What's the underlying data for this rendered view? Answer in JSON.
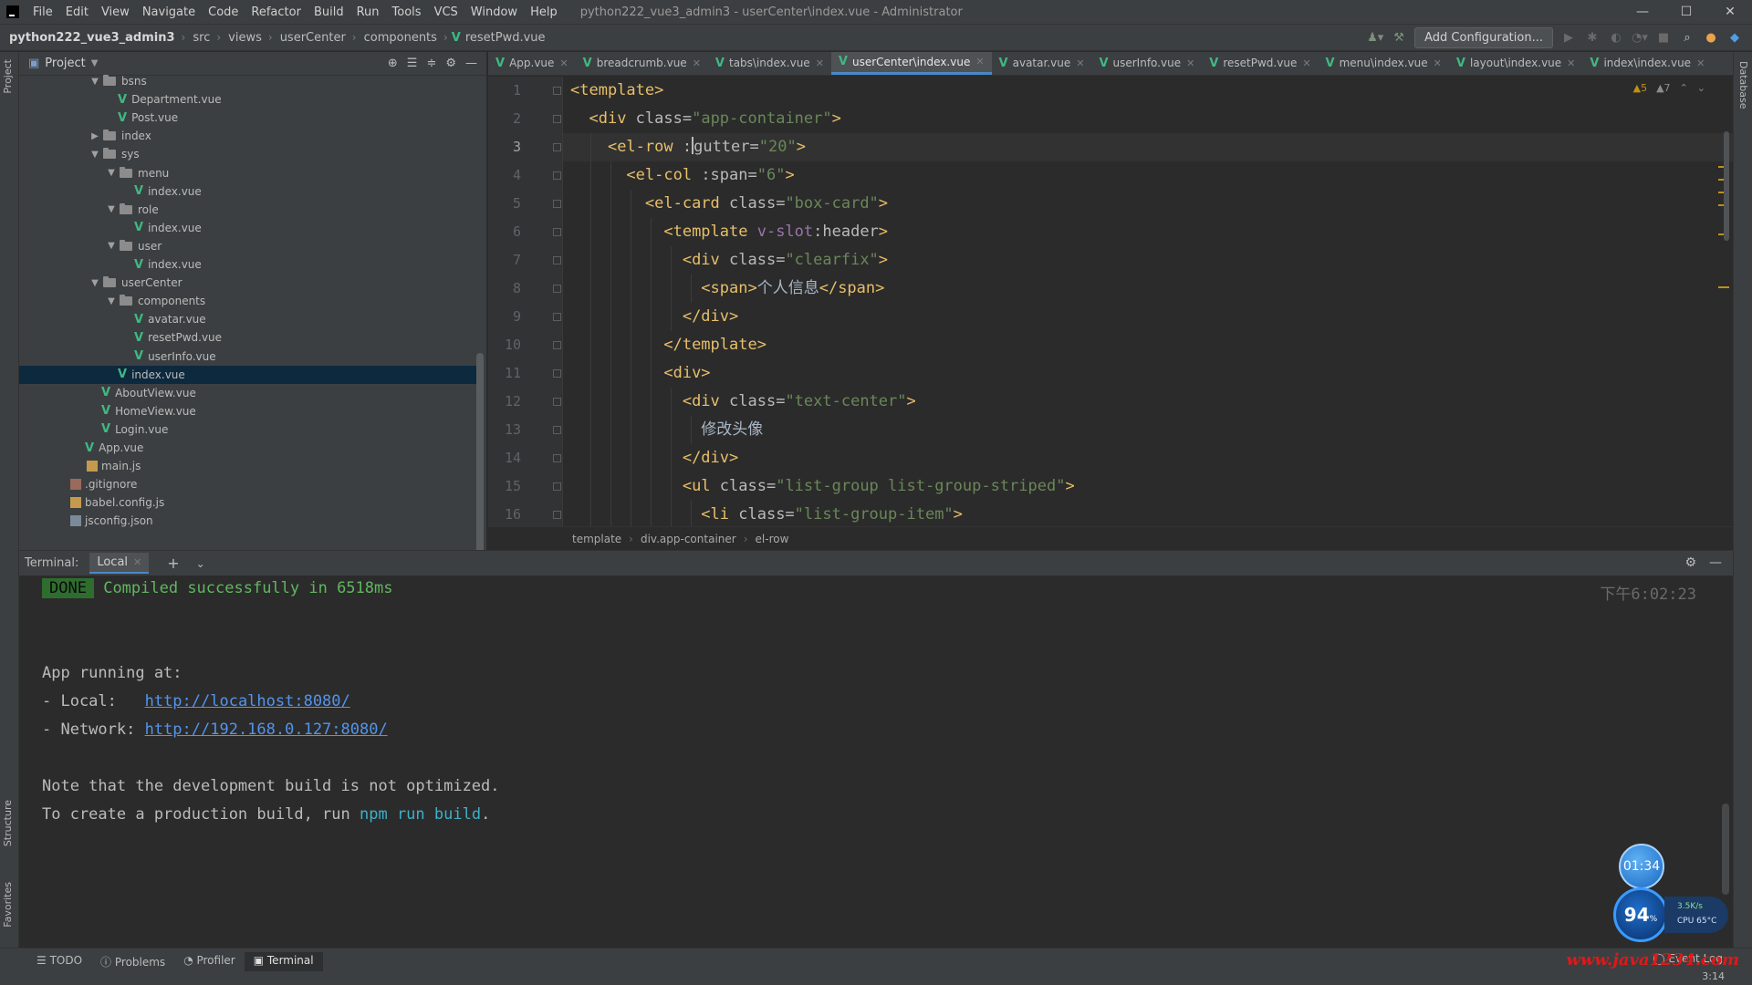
{
  "menubar": {
    "items": [
      "File",
      "Edit",
      "View",
      "Navigate",
      "Code",
      "Refactor",
      "Build",
      "Run",
      "Tools",
      "VCS",
      "Window",
      "Help"
    ],
    "window_title": "python222_vue3_admin3 - userCenter\\index.vue - Administrator",
    "controls": [
      "—",
      "☐",
      "✕"
    ]
  },
  "navbar": {
    "crumbs": [
      "python222_vue3_admin3",
      "src",
      "views",
      "userCenter",
      "components",
      "resetPwd.vue"
    ],
    "add_config": "Add Configuration..."
  },
  "left_strip": {
    "tabs": [
      "Project",
      "Structure",
      "Favorites"
    ]
  },
  "right_strip": {
    "tabs": [
      "Database"
    ]
  },
  "project": {
    "title": "Project",
    "tree": [
      {
        "label": "bsns",
        "type": "folder",
        "open": true,
        "depth": 3
      },
      {
        "label": "Department.vue",
        "type": "vue",
        "depth": 4
      },
      {
        "label": "Post.vue",
        "type": "vue",
        "depth": 4
      },
      {
        "label": "index",
        "type": "folder",
        "open": false,
        "depth": 3
      },
      {
        "label": "sys",
        "type": "folder",
        "open": true,
        "depth": 3
      },
      {
        "label": "menu",
        "type": "folder",
        "open": true,
        "depth": 4
      },
      {
        "label": "index.vue",
        "type": "vue",
        "depth": 5
      },
      {
        "label": "role",
        "type": "folder",
        "open": true,
        "depth": 4
      },
      {
        "label": "index.vue",
        "type": "vue",
        "depth": 5
      },
      {
        "label": "user",
        "type": "folder",
        "open": true,
        "depth": 4
      },
      {
        "label": "index.vue",
        "type": "vue",
        "depth": 5
      },
      {
        "label": "userCenter",
        "type": "folder",
        "open": true,
        "depth": 3
      },
      {
        "label": "components",
        "type": "folder",
        "open": true,
        "depth": 4
      },
      {
        "label": "avatar.vue",
        "type": "vue",
        "depth": 5
      },
      {
        "label": "resetPwd.vue",
        "type": "vue",
        "depth": 5
      },
      {
        "label": "userInfo.vue",
        "type": "vue",
        "depth": 5
      },
      {
        "label": "index.vue",
        "type": "vue",
        "depth": 4,
        "selected": true
      },
      {
        "label": "AboutView.vue",
        "type": "vue",
        "depth": 3
      },
      {
        "label": "HomeView.vue",
        "type": "vue",
        "depth": 3
      },
      {
        "label": "Login.vue",
        "type": "vue",
        "depth": 3
      },
      {
        "label": "App.vue",
        "type": "vue",
        "depth": 2
      },
      {
        "label": "main.js",
        "type": "js",
        "depth": 2
      },
      {
        "label": ".gitignore",
        "type": "git",
        "depth": 1
      },
      {
        "label": "babel.config.js",
        "type": "js",
        "depth": 1
      },
      {
        "label": "jsconfig.json",
        "type": "cfg",
        "depth": 1
      }
    ]
  },
  "editor_tabs": [
    {
      "label": "App.vue"
    },
    {
      "label": "breadcrumb.vue"
    },
    {
      "label": "tabs\\index.vue"
    },
    {
      "label": "userCenter\\index.vue",
      "active": true
    },
    {
      "label": "avatar.vue"
    },
    {
      "label": "userInfo.vue"
    },
    {
      "label": "resetPwd.vue"
    },
    {
      "label": "menu\\index.vue"
    },
    {
      "label": "layout\\index.vue"
    },
    {
      "label": "index\\index.vue"
    }
  ],
  "editor": {
    "inspect_warn": "▲5",
    "inspect_weak": "▲7",
    "current_line": 3,
    "lines": [
      {
        "n": "1",
        "indent": 0,
        "tokens": [
          {
            "c": "tag",
            "t": "<template>"
          }
        ]
      },
      {
        "n": "2",
        "indent": 1,
        "tokens": [
          {
            "c": "tag",
            "t": "<div "
          },
          {
            "c": "attr",
            "t": "class="
          },
          {
            "c": "val",
            "t": "\"app-container\""
          },
          {
            "c": "tag",
            "t": ">"
          }
        ]
      },
      {
        "n": "3",
        "indent": 2,
        "tokens": [
          {
            "c": "tag",
            "t": "<el-row "
          },
          {
            "c": "attr",
            "t": ":"
          },
          {
            "c": "caret",
            "t": ""
          },
          {
            "c": "attr",
            "t": "gutter="
          },
          {
            "c": "val",
            "t": "\"20\""
          },
          {
            "c": "tag",
            "t": ">"
          }
        ]
      },
      {
        "n": "4",
        "indent": 3,
        "tokens": [
          {
            "c": "tag",
            "t": "<el-col "
          },
          {
            "c": "attr",
            "t": ":span="
          },
          {
            "c": "val",
            "t": "\"6\""
          },
          {
            "c": "tag",
            "t": ">"
          }
        ]
      },
      {
        "n": "5",
        "indent": 4,
        "tokens": [
          {
            "c": "tag",
            "t": "<el-card "
          },
          {
            "c": "attr",
            "t": "class="
          },
          {
            "c": "val",
            "t": "\"box-card\""
          },
          {
            "c": "tag",
            "t": ">"
          }
        ]
      },
      {
        "n": "6",
        "indent": 5,
        "tokens": [
          {
            "c": "tag",
            "t": "<template "
          },
          {
            "c": "vattr",
            "t": "v-slot"
          },
          {
            "c": "attr",
            "t": ":header"
          },
          {
            "c": "tag",
            "t": ">"
          }
        ]
      },
      {
        "n": "7",
        "indent": 6,
        "tokens": [
          {
            "c": "tag",
            "t": "<div "
          },
          {
            "c": "attr",
            "t": "class="
          },
          {
            "c": "val",
            "t": "\"clearfix\""
          },
          {
            "c": "tag",
            "t": ">"
          }
        ]
      },
      {
        "n": "8",
        "indent": 7,
        "tokens": [
          {
            "c": "tag",
            "t": "<span>"
          },
          {
            "c": "txt",
            "t": "个人信息"
          },
          {
            "c": "tag",
            "t": "</span>"
          }
        ]
      },
      {
        "n": "9",
        "indent": 6,
        "tokens": [
          {
            "c": "tag",
            "t": "</div>"
          }
        ]
      },
      {
        "n": "10",
        "indent": 5,
        "tokens": [
          {
            "c": "tag",
            "t": "</template>"
          }
        ]
      },
      {
        "n": "11",
        "indent": 5,
        "tokens": [
          {
            "c": "tag",
            "t": "<div>"
          }
        ]
      },
      {
        "n": "12",
        "indent": 6,
        "tokens": [
          {
            "c": "tag",
            "t": "<div "
          },
          {
            "c": "attr",
            "t": "class="
          },
          {
            "c": "val",
            "t": "\"text-center\""
          },
          {
            "c": "tag",
            "t": ">"
          }
        ]
      },
      {
        "n": "13",
        "indent": 7,
        "tokens": [
          {
            "c": "txt",
            "t": "修改头像"
          }
        ]
      },
      {
        "n": "14",
        "indent": 6,
        "tokens": [
          {
            "c": "tag",
            "t": "</div>"
          }
        ]
      },
      {
        "n": "15",
        "indent": 6,
        "tokens": [
          {
            "c": "tag",
            "t": "<ul "
          },
          {
            "c": "attr",
            "t": "class="
          },
          {
            "c": "val",
            "t": "\"list-group list-group-striped\""
          },
          {
            "c": "tag",
            "t": ">"
          }
        ]
      },
      {
        "n": "16",
        "indent": 7,
        "tokens": [
          {
            "c": "tag",
            "t": "<li "
          },
          {
            "c": "attr",
            "t": "class="
          },
          {
            "c": "val",
            "t": "\"list-group-item\""
          },
          {
            "c": "tag",
            "t": ">"
          }
        ]
      }
    ]
  },
  "editor_crumbs": [
    "template",
    "div.app-container",
    "el-row"
  ],
  "terminal": {
    "label": "Terminal:",
    "tab": "Local",
    "done": "DONE",
    "compiled": "Compiled successfully in 6518ms",
    "time": "下午6:02:23",
    "app_running": "App running at:",
    "local_label": "- Local:   ",
    "local_url": "http://localhost:8080/",
    "network_label": "- Network: ",
    "network_url": "http://192.168.0.127:8080/",
    "note": "Note that the development build is not optimized.",
    "prod_prefix": "To create a production build, run ",
    "prod_cmd": "npm run build",
    "prod_suffix": "."
  },
  "widget": {
    "timer": "01:34",
    "cpu_value": "94",
    "cpu_unit": "%",
    "net_speed": "3.5K/s",
    "cpu_temp": "CPU 65°C"
  },
  "statusbar": {
    "tools": [
      {
        "label": "TODO"
      },
      {
        "label": "Problems"
      },
      {
        "label": "Profiler"
      },
      {
        "label": "Terminal",
        "active": true
      }
    ],
    "event_log": "Event Log",
    "position": "3:14"
  },
  "watermark": "www.java1234.com",
  "colors": {
    "vue": "#41b883",
    "accent": "#4a88c7",
    "tag": "#e8bf6a",
    "value": "#6a8759",
    "success": "#5fb85f",
    "link": "#5394ec"
  }
}
